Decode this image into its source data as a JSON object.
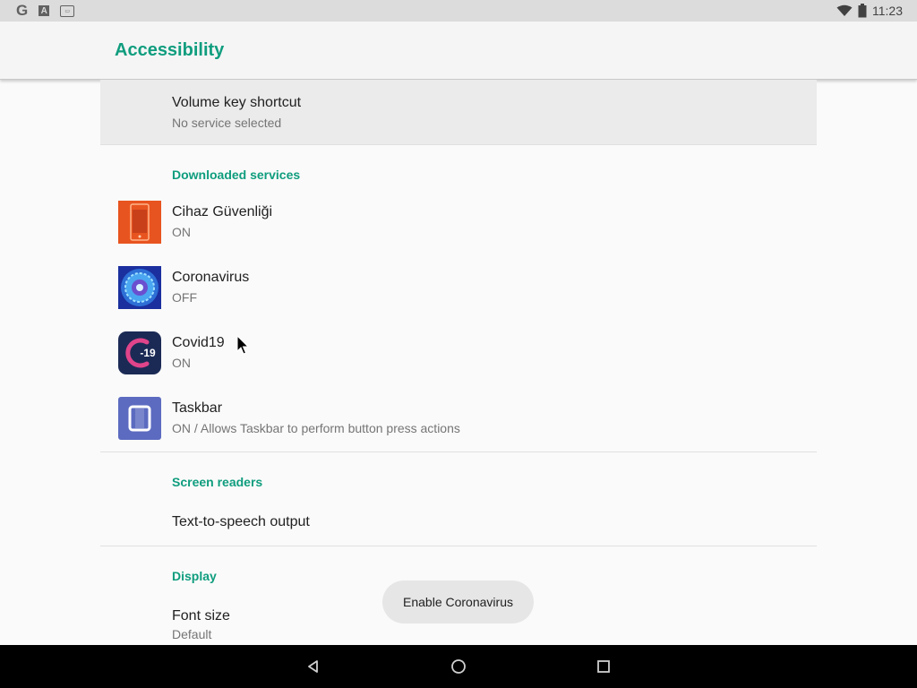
{
  "status_bar": {
    "left_icons": [
      "google-icon",
      "font-a-icon",
      "captions-icon"
    ],
    "g_letter": "G",
    "a_letter": "A",
    "time": "11:23"
  },
  "toolbar": {
    "title": "Accessibility"
  },
  "volume_shortcut": {
    "title": "Volume key shortcut",
    "summary": "No service selected"
  },
  "downloaded_services": {
    "header": "Downloaded services",
    "items": [
      {
        "title": "Cihaz Güvenliği",
        "summary": "ON",
        "icon": "cihaz-guvenligi-app-icon"
      },
      {
        "title": "Coronavirus",
        "summary": "OFF",
        "icon": "coronavirus-app-icon"
      },
      {
        "title": "Covid19",
        "summary": "ON",
        "icon": "covid19-app-icon",
        "icon_text": "-19"
      },
      {
        "title": "Taskbar",
        "summary": "ON / Allows Taskbar to perform button press actions",
        "icon": "taskbar-app-icon"
      }
    ]
  },
  "screen_readers": {
    "header": "Screen readers",
    "items": [
      {
        "title": "Text-to-speech output"
      }
    ]
  },
  "display": {
    "header": "Display",
    "items": [
      {
        "title": "Font size",
        "summary": "Default"
      }
    ]
  },
  "toast": {
    "text": "Enable Coronavirus"
  },
  "colors": {
    "accent": "#0f9d7e",
    "status_bar": "#dcdcdc",
    "nav_bar": "#000000"
  }
}
